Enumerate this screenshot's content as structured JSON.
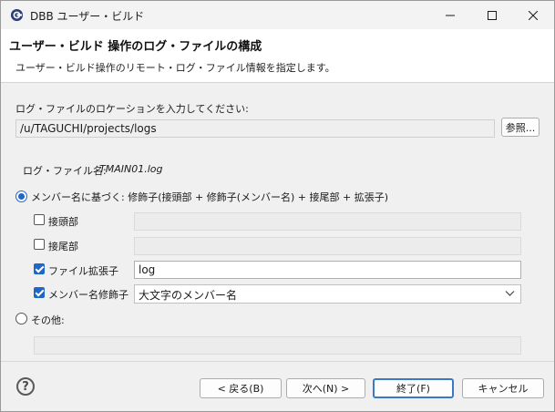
{
  "window": {
    "title": "DBB ユーザー・ビルド"
  },
  "header": {
    "title": "ユーザー・ビルド 操作のログ・ファイルの構成",
    "description": "ユーザー・ビルド操作のリモート・ログ・ファイル情報を指定します。"
  },
  "location": {
    "label": "ログ・ファイルのロケーションを入力してください:",
    "value": "/u/TAGUCHI/projects/logs",
    "browse_label": "参照..."
  },
  "log_file": {
    "label": "ログ・ファイル名:",
    "value": "TMAIN01.log"
  },
  "options": {
    "member_radio_label": "メンバー名に基づく: 修飾子(接頭部 + 修飾子(メンバー名) + 接尾部 + 拡張子)",
    "prefix_label": "接頭部",
    "prefix_value": "",
    "suffix_label": "接尾部",
    "suffix_value": "",
    "ext_label": "ファイル拡張子",
    "ext_value": "log",
    "modifier_label": "メンバー名修飾子",
    "modifier_value": "大文字のメンバー名",
    "other_radio_label": "その他:",
    "other_value": ""
  },
  "footer": {
    "back_label": "< 戻る(B)",
    "next_label": "次へ(N) >",
    "finish_label": "終了(F)",
    "cancel_label": "キャンセル"
  },
  "state": {
    "member_radio_checked": true,
    "other_radio_checked": false,
    "prefix_checked": false,
    "suffix_checked": false,
    "ext_checked": true,
    "modifier_checked": true
  },
  "colors": {
    "accent": "#1f67c7",
    "header_bg": "#ffffff",
    "body_bg": "#f0f0f0"
  }
}
